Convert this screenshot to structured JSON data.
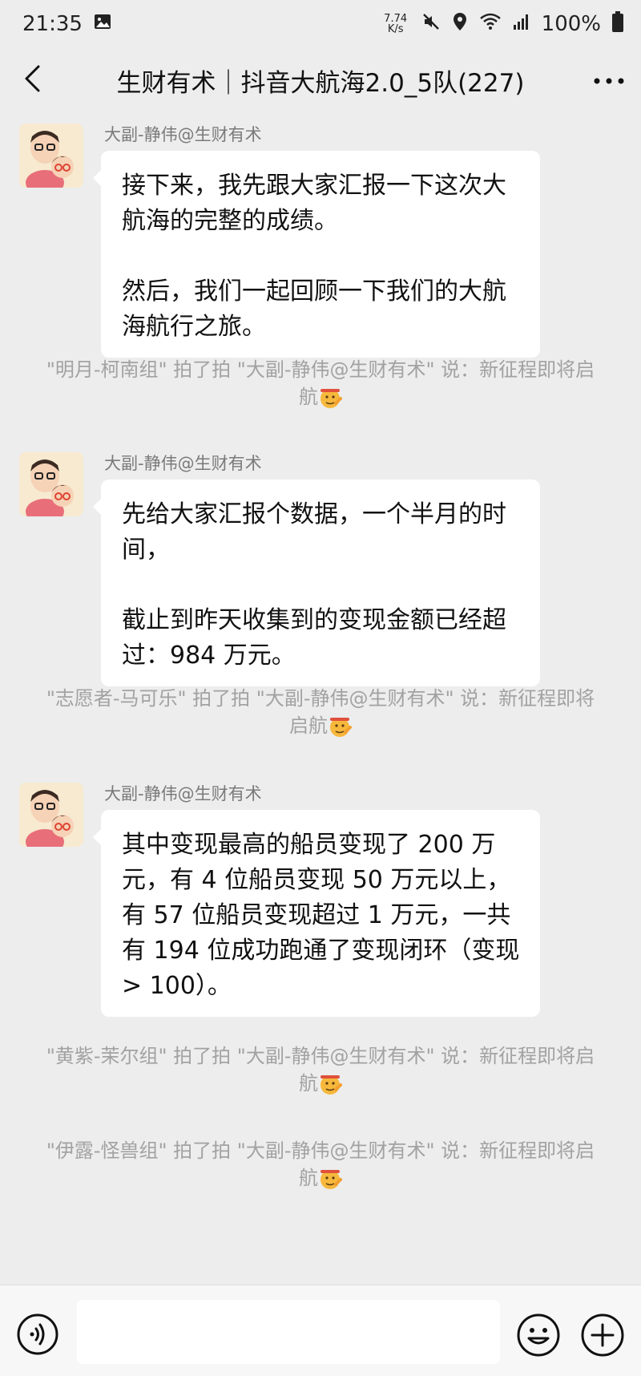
{
  "status_bar": {
    "time": "21:35",
    "net_speed_value": "7.74",
    "net_speed_unit": "K/s",
    "battery": "100%",
    "icons": [
      "gallery-icon",
      "mute-icon",
      "location-icon",
      "wifi-icon",
      "signal-icon",
      "battery-icon"
    ]
  },
  "nav": {
    "title": "生财有术｜抖音大航海2.0_5队(227)",
    "back_icon": "chevron-left-icon",
    "more_icon": "more-dots-icon"
  },
  "messages": [
    {
      "sender": "大副-静伟@生财有术",
      "paragraphs": [
        "接下来，我先跟大家汇报一下这次大航海的完整的成绩。",
        "然后，我们一起回顾一下我们的大航海航行之旅。"
      ]
    },
    {
      "sender": "大副-静伟@生财有术",
      "paragraphs": [
        "先给大家汇报个数据，一个半月的时间，",
        "截止到昨天收集到的变现金额已经超过：984 万元。"
      ]
    },
    {
      "sender": "大副-静伟@生财有术",
      "paragraphs": [
        "其中变现最高的船员变现了 200 万元，有 4 位船员变现 50 万元以上，有 57 位船员变现超过 1 万元，一共有 194 位成功跑通了变现闭环（变现 > 100）。"
      ]
    }
  ],
  "system_notices": [
    {
      "text": "\"明月-柯南组\" 拍了拍 \"大副-静伟@生财有术\" 说：新征程即将启航",
      "emoji": "salute-face-icon"
    },
    {
      "text": "\"志愿者-马可乐\" 拍了拍 \"大副-静伟@生财有术\" 说：新征程即将启航",
      "emoji": "salute-face-icon"
    },
    {
      "text": "\"黄紫-茉尔组\" 拍了拍 \"大副-静伟@生财有术\" 说：新征程即将启航",
      "emoji": "salute-face-icon"
    },
    {
      "text": "\"伊露-怪兽组\" 拍了拍 \"大副-静伟@生财有术\" 说：新征程即将启航",
      "emoji": "salute-face-icon"
    }
  ],
  "input_bar": {
    "value": "",
    "icons": [
      "voice-icon",
      "emoji-icon",
      "plus-icon"
    ]
  },
  "colors": {
    "background": "#ededed",
    "bubble": "#ffffff",
    "system_text": "#a2a2a2",
    "sender_text": "#7a7a7a"
  }
}
